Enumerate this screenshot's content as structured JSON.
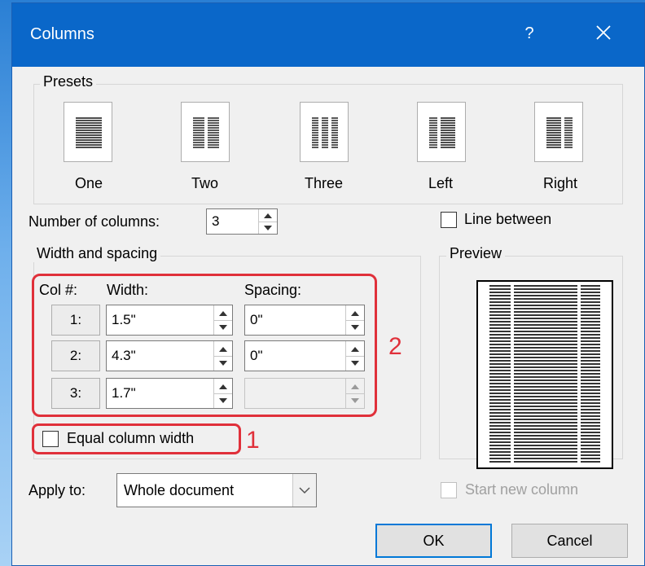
{
  "dialog": {
    "title": "Columns",
    "help_label": "?"
  },
  "presets": {
    "group_label": "Presets",
    "items": [
      {
        "label": "One"
      },
      {
        "label": "Two"
      },
      {
        "label": "Three"
      },
      {
        "label": "Left"
      },
      {
        "label": "Right"
      }
    ]
  },
  "number_of_columns": {
    "label": "Number of columns:",
    "value": "3"
  },
  "line_between": {
    "label": "Line between",
    "checked": false
  },
  "width_spacing": {
    "group_label": "Width and spacing",
    "headers": {
      "col": "Col #:",
      "width": "Width:",
      "spacing": "Spacing:"
    },
    "rows": [
      {
        "col": "1:",
        "width": "1.5\"",
        "spacing": "0\""
      },
      {
        "col": "2:",
        "width": "4.3\"",
        "spacing": "0\""
      },
      {
        "col": "3:",
        "width": "1.7\"",
        "spacing": ""
      }
    ]
  },
  "equal_column_width": {
    "label": "Equal column width",
    "checked": false
  },
  "annotations": {
    "one": "1",
    "two": "2",
    "color": "#e0303a"
  },
  "preview": {
    "label": "Preview"
  },
  "apply_to": {
    "label": "Apply to:",
    "value": "Whole document"
  },
  "start_new_column": {
    "label": "Start new column",
    "checked": false,
    "enabled": false
  },
  "buttons": {
    "ok": "OK",
    "cancel": "Cancel"
  },
  "colors": {
    "titlebar": "#0a67c9",
    "dialog_bg": "#f0f0f0",
    "default_button_border": "#0078d7"
  }
}
